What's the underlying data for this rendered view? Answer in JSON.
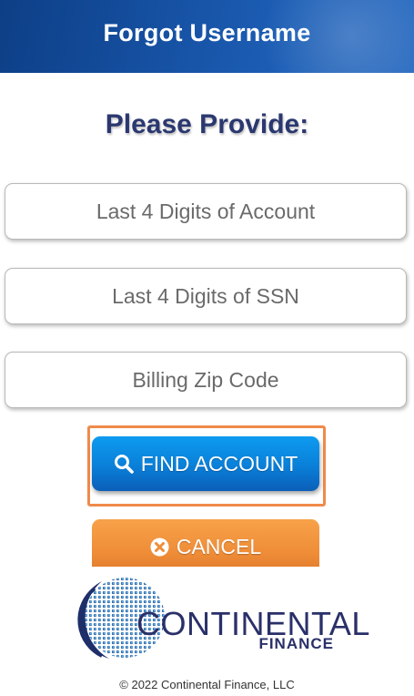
{
  "header": {
    "title": "Forgot Username"
  },
  "form": {
    "subtitle": "Please Provide:",
    "fields": [
      {
        "placeholder": "Last 4 Digits of Account",
        "value": ""
      },
      {
        "placeholder": "Last 4 Digits of SSN",
        "value": ""
      },
      {
        "placeholder": "Billing Zip Code",
        "value": ""
      }
    ]
  },
  "buttons": {
    "find": {
      "label": "FIND ACCOUNT",
      "icon": "search-icon"
    },
    "cancel": {
      "label": "CANCEL",
      "icon": "x-circle-icon"
    }
  },
  "logo": {
    "name": "CONTINENTAL",
    "sub": "FINANCE"
  },
  "footer": {
    "copyright": "© 2022 Continental Finance, LLC"
  },
  "colors": {
    "header": "#1753a6",
    "subtitle": "#2b3870",
    "find_button": "#0a7fd8",
    "cancel_button": "#ef8d38",
    "focus_ring": "#f08a4b",
    "logo_text": "#2a3068"
  }
}
